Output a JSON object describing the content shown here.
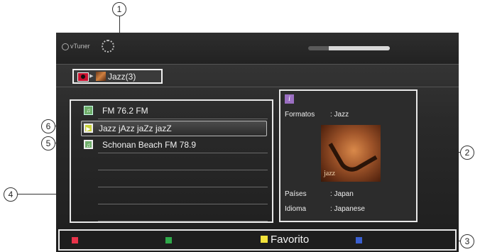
{
  "app": {
    "logo_text": "vTuner",
    "progress_fraction": 0.75
  },
  "breadcrumb": {
    "separator": "▸",
    "label": "Jazz(3)"
  },
  "station_list": {
    "rows": [
      {
        "label": "FM 76.2 FM",
        "icon": "radio-station-icon",
        "state": "normal"
      },
      {
        "label": "Jazz jAzz jaZz jazZ",
        "icon": "play-icon",
        "state": "selected"
      },
      {
        "label": "Schonan Beach FM 78.9",
        "icon": "radio-station-icon",
        "state": "focused"
      },
      {
        "label": "",
        "state": "empty"
      },
      {
        "label": "",
        "state": "empty"
      },
      {
        "label": "",
        "state": "empty"
      },
      {
        "label": "",
        "state": "empty"
      }
    ]
  },
  "info": {
    "icon_glyph": "i",
    "format_label": "Formatos",
    "format_value": ": Jazz",
    "album_text": "jazz",
    "country_label": "Países",
    "country_value": ": Japan",
    "language_label": "Idioma",
    "language_value": ": Japanese"
  },
  "color_buttons": {
    "red": "#e8334a",
    "green": "#2faa4a",
    "yellow": "#f2e23a",
    "blue": "#3a5fd0",
    "yellow_label": "Favorito"
  },
  "callouts": [
    "1",
    "2",
    "3",
    "4",
    "5",
    "6"
  ]
}
